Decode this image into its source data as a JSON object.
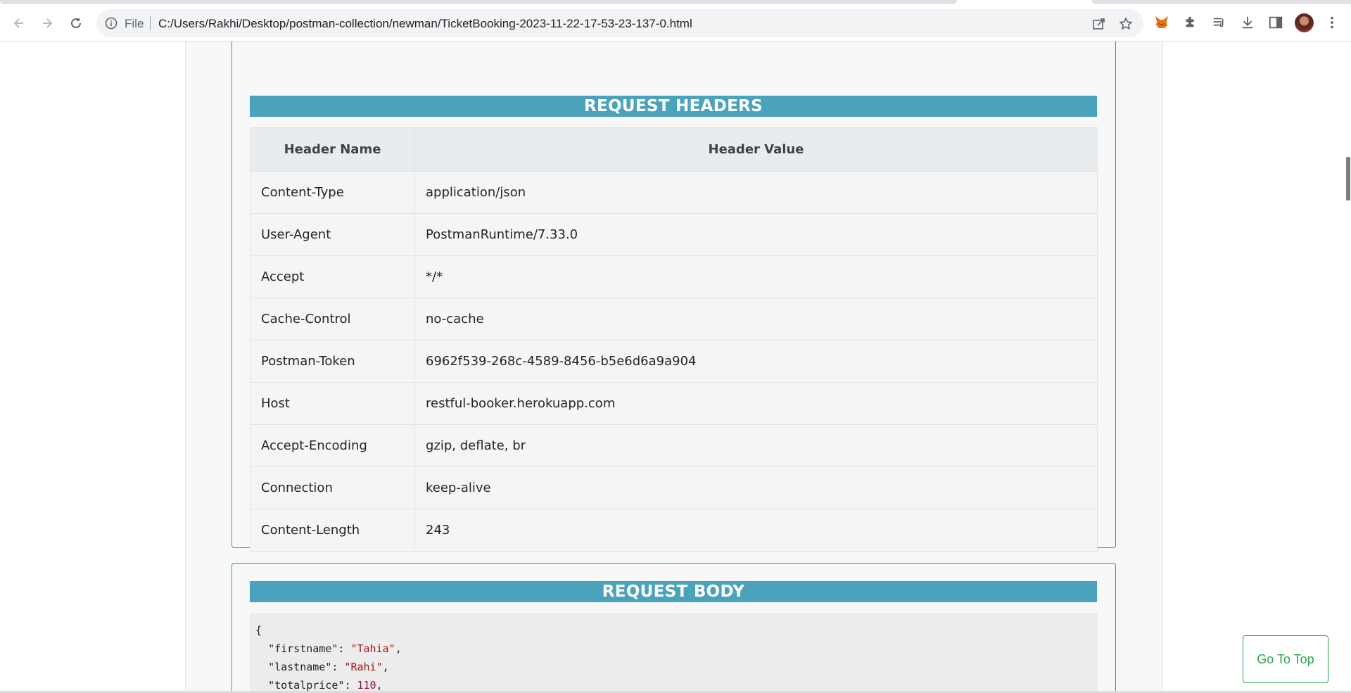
{
  "browser": {
    "scheme_label": "File",
    "url": "C:/Users/Rakhi/Desktop/postman-collection/newman/TicketBooking-2023-11-22-17-53-23-137-0.html",
    "icons": [
      "back-icon",
      "forward-icon",
      "reload-icon",
      "info-icon",
      "share-icon",
      "star-icon",
      "metamask-fox-icon",
      "extensions-puzzle-icon",
      "media-queue-icon",
      "download-icon",
      "side-panel-icon",
      "profile-avatar",
      "kebab-menu-icon"
    ]
  },
  "request_headers": {
    "title": "REQUEST HEADERS",
    "columns": [
      "Header Name",
      "Header Value"
    ],
    "rows": [
      {
        "name": "Content-Type",
        "value": "application/json"
      },
      {
        "name": "User-Agent",
        "value": "PostmanRuntime/7.33.0"
      },
      {
        "name": "Accept",
        "value": "*/*"
      },
      {
        "name": "Cache-Control",
        "value": "no-cache"
      },
      {
        "name": "Postman-Token",
        "value": "6962f539-268c-4589-8456-b5e6d6a9a904"
      },
      {
        "name": "Host",
        "value": "restful-booker.herokuapp.com"
      },
      {
        "name": "Accept-Encoding",
        "value": "gzip, deflate, br"
      },
      {
        "name": "Connection",
        "value": "keep-alive"
      },
      {
        "name": "Content-Length",
        "value": "243"
      }
    ]
  },
  "request_body": {
    "title": "REQUEST BODY",
    "open_brace": "{",
    "fields": [
      {
        "key": "\"firstname\"",
        "value": "\"Tahia\"",
        "kind": "string"
      },
      {
        "key": "\"lastname\"",
        "value": "\"Rahi\"",
        "kind": "string"
      },
      {
        "key": "\"totalprice\"",
        "value": "110",
        "kind": "number"
      }
    ]
  },
  "go_top_label": "Go To Top",
  "colors": {
    "section_header": "#4aa3ba",
    "card_border": "#17a2b8",
    "go_top": "#28a745"
  }
}
